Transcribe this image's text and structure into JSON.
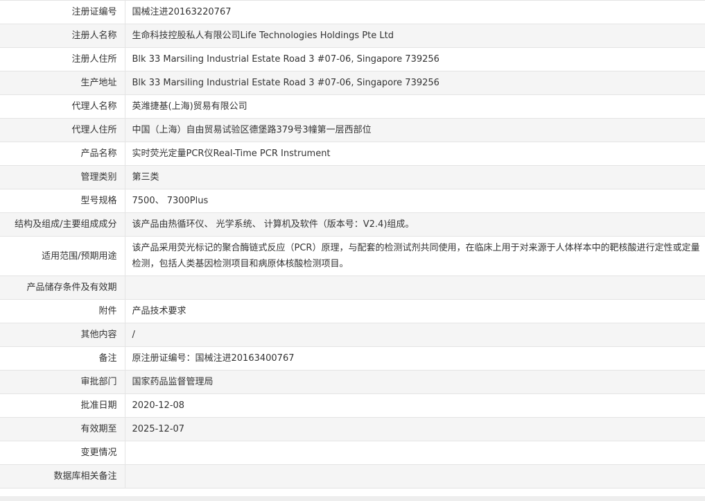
{
  "rows": [
    {
      "label": "注册证编号",
      "value": "国械注进20163220767"
    },
    {
      "label": "注册人名称",
      "value": "生命科技控股私人有限公司Life Technologies Holdings Pte Ltd"
    },
    {
      "label": "注册人住所",
      "value": "Blk 33 Marsiling Industrial Estate Road 3 #07-06, Singapore 739256"
    },
    {
      "label": "生产地址",
      "value": "Blk 33 Marsiling Industrial Estate Road 3 #07-06, Singapore 739256"
    },
    {
      "label": "代理人名称",
      "value": "英潍捷基(上海)贸易有限公司"
    },
    {
      "label": "代理人住所",
      "value": "中国（上海）自由贸易试验区德堡路379号3幢第一层西部位"
    },
    {
      "label": "产品名称",
      "value": "实时荧光定量PCR仪Real-Time PCR Instrument"
    },
    {
      "label": "管理类别",
      "value": "第三类"
    },
    {
      "label": "型号规格",
      "value": "7500、 7300Plus"
    },
    {
      "label": "结构及组成/主要组成成分",
      "value": "该产品由热循环仪、 光学系统、 计算机及软件（版本号：V2.4)组成。"
    },
    {
      "label": "适用范围/预期用途",
      "value": "该产品采用荧光标记的聚合酶链式反应（PCR）原理，与配套的检测试剂共同使用，在临床上用于对来源于人体样本中的靶核酸进行定性或定量检测，包括人类基因检测项目和病原体核酸检测项目。"
    },
    {
      "label": "产品储存条件及有效期",
      "value": ""
    },
    {
      "label": "附件",
      "value": "产品技术要求"
    },
    {
      "label": "其他内容",
      "value": "/"
    },
    {
      "label": "备注",
      "value": "原注册证编号：国械注进20163400767"
    },
    {
      "label": "审批部门",
      "value": "国家药品监督管理局"
    },
    {
      "label": "批准日期",
      "value": "2020-12-08"
    },
    {
      "label": "有效期至",
      "value": "2025-12-07"
    },
    {
      "label": "变更情况",
      "value": ""
    },
    {
      "label": "数据库相关备注",
      "value": ""
    }
  ]
}
